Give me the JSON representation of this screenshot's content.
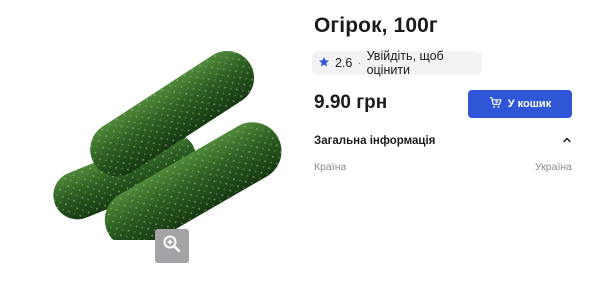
{
  "product": {
    "title": "Огірок, 100г",
    "price": "9.90 грн"
  },
  "rating": {
    "value": "2.6",
    "separator": "·",
    "login_prompt": "Увійдіть, щоб оцінити",
    "star_color": "#2f56d6"
  },
  "actions": {
    "add_to_cart_label": "У кошик",
    "accent_color": "#2f56d6"
  },
  "info": {
    "section_title": "Загальна інформація",
    "rows": [
      {
        "key": "Країна",
        "value": "Україна"
      }
    ]
  },
  "icons": {
    "zoom": "zoom-in-icon",
    "cart": "cart-plus-icon",
    "star": "star-icon",
    "collapse": "chevron-up-icon"
  }
}
